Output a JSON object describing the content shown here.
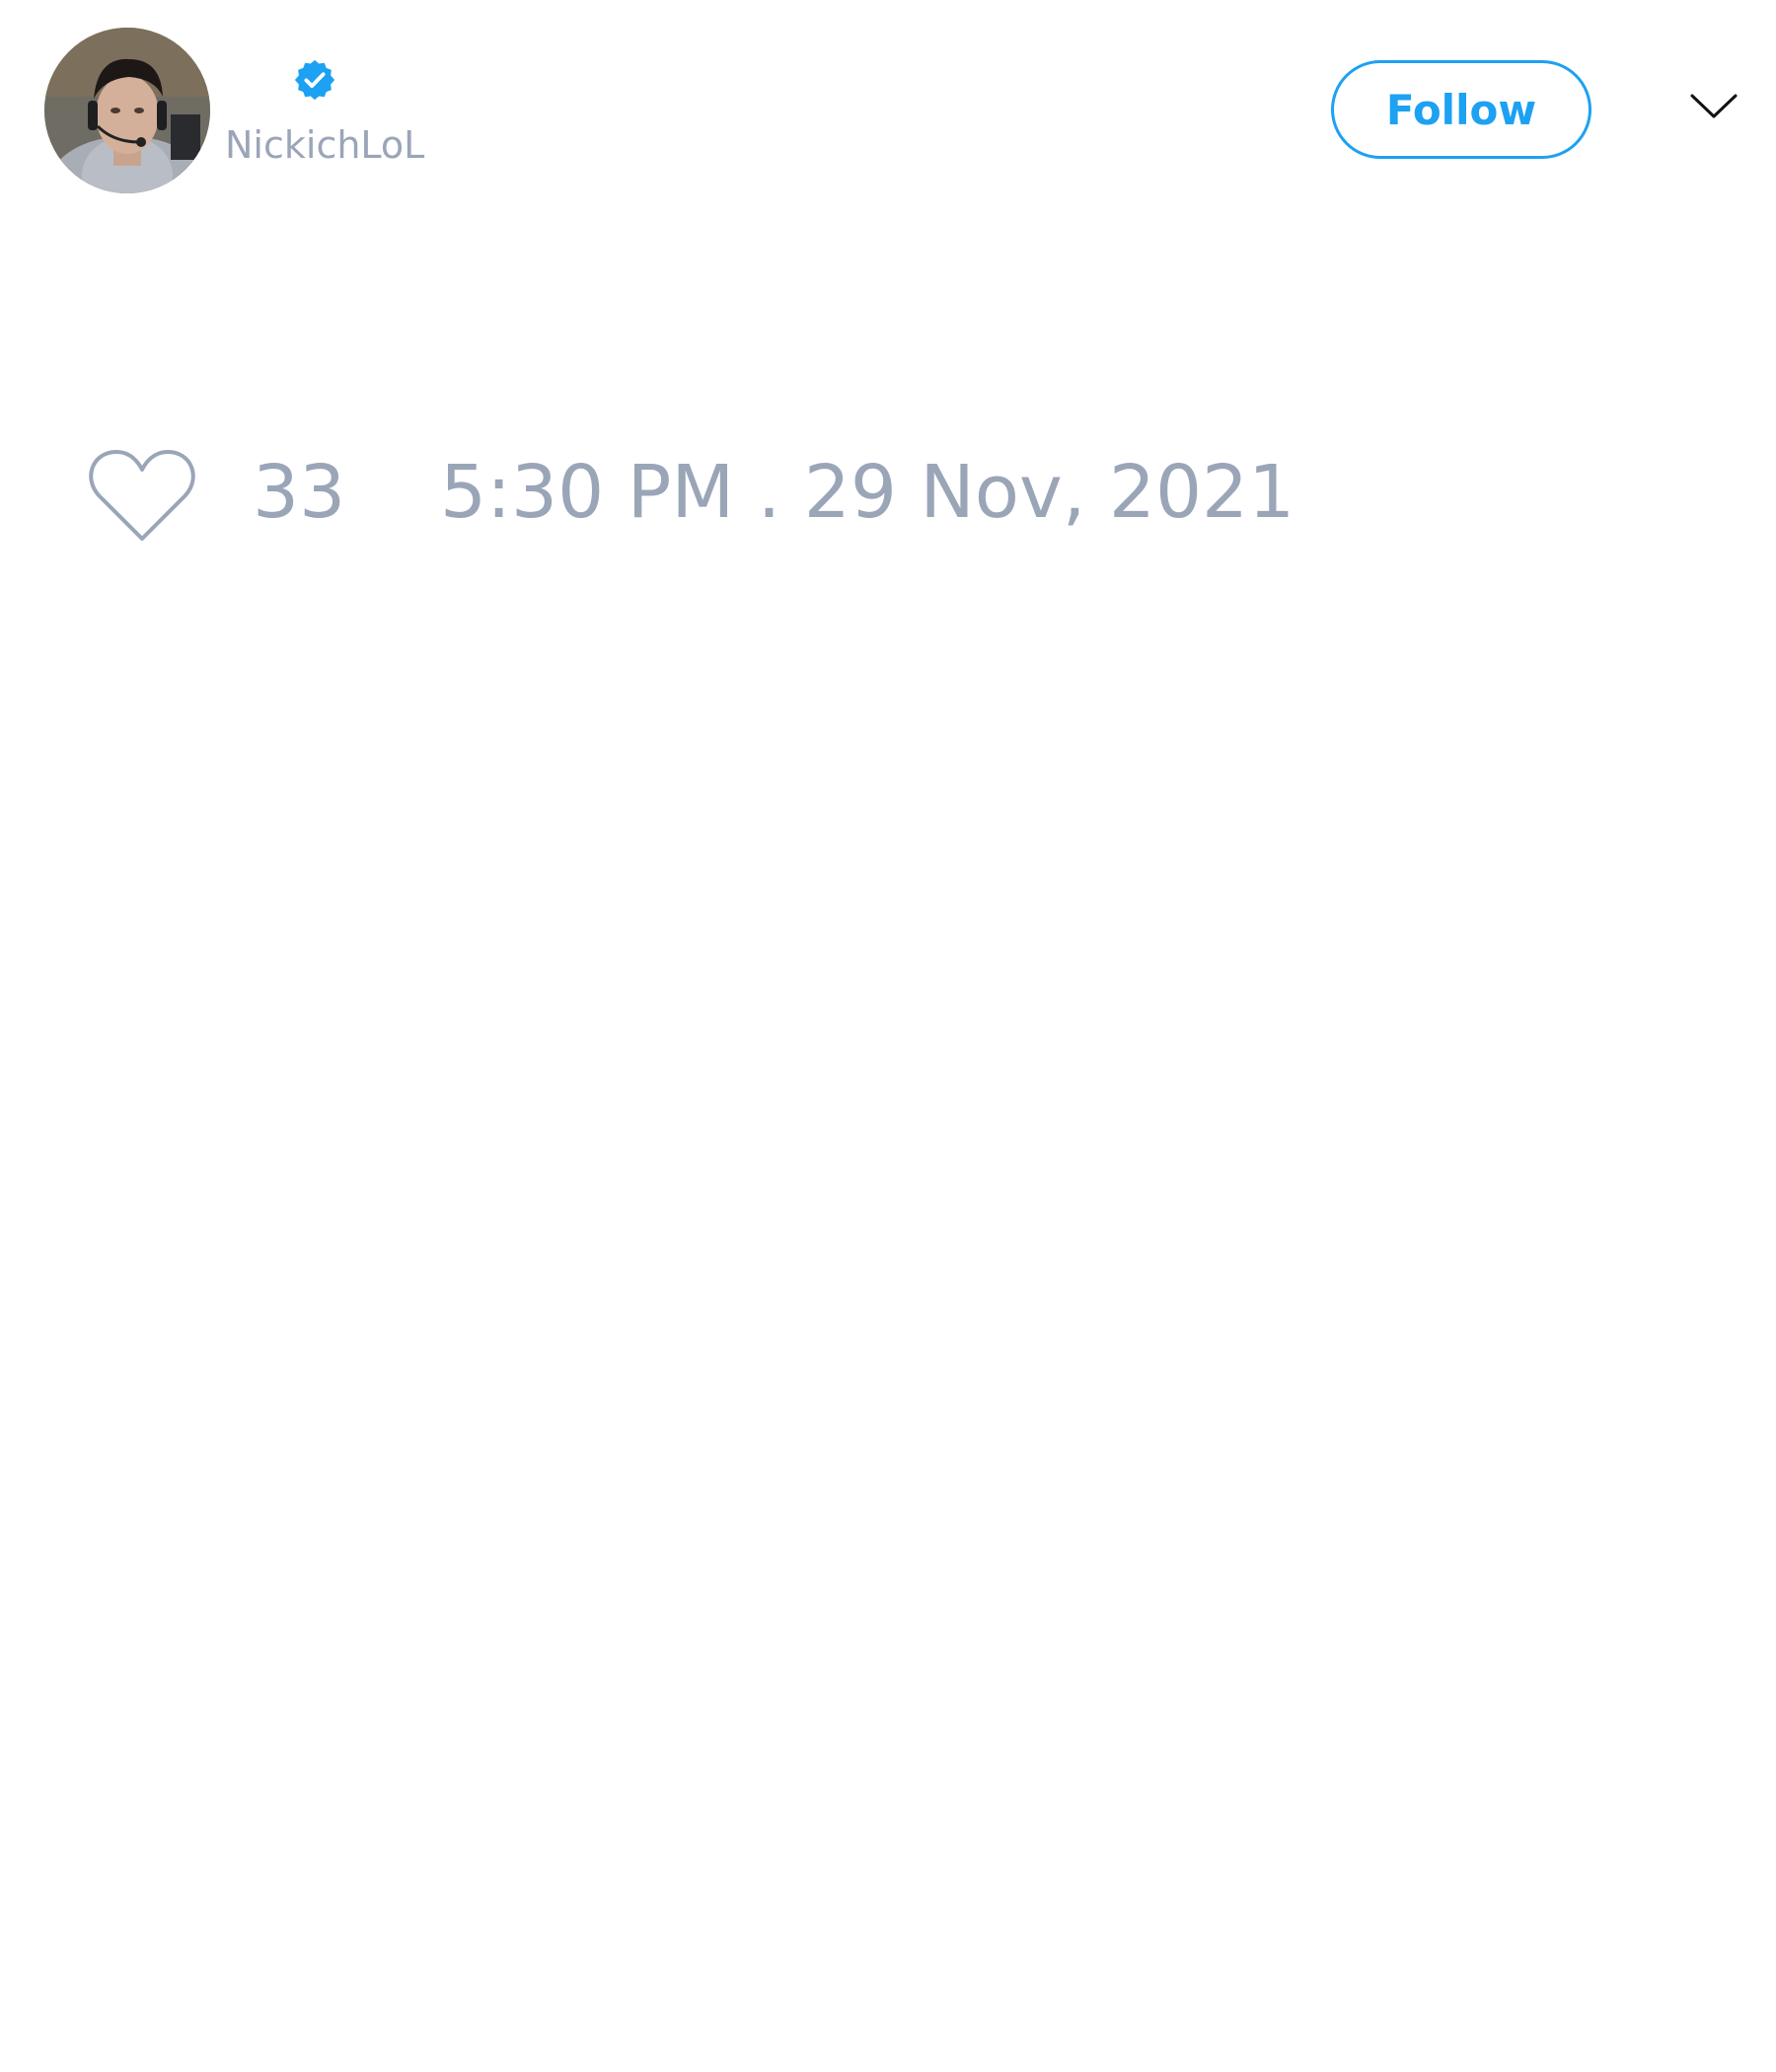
{
  "tweet": {
    "author": {
      "handle": "NickichLoL",
      "verified": true,
      "avatar_icon": "profile-photo",
      "verified_icon": "verified-badge-icon"
    },
    "follow_label": "Follow",
    "menu_icon": "chevron-down-icon",
    "likes": {
      "icon": "heart-icon",
      "count": "33"
    },
    "timestamp": "5:30 PM . 29 Nov, 2021"
  },
  "colors": {
    "accent": "#1da1f2",
    "muted_text": "#9aa5b8",
    "background": "#ffffff"
  }
}
